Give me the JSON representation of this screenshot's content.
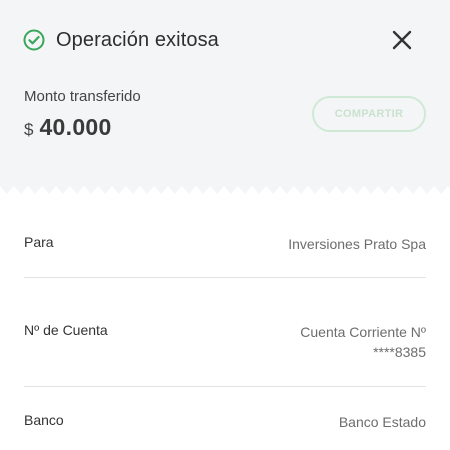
{
  "header": {
    "title": "Operación exitosa",
    "status_icon": "check-circle-icon",
    "close_icon": "close-icon"
  },
  "amount": {
    "label": "Monto transferido",
    "currency": "$",
    "value": "40.000"
  },
  "share_button": {
    "label": "COMPARTIR"
  },
  "details": [
    {
      "label": "Para",
      "value_lines": [
        "Inversiones Prato Spa"
      ]
    },
    {
      "label": "Nº de Cuenta",
      "value_lines": [
        "Cuenta Corriente Nº",
        "****8385"
      ]
    },
    {
      "label": "Banco",
      "value_lines": [
        "Banco Estado"
      ]
    }
  ],
  "colors": {
    "accent_green": "#3aa65c",
    "top_background": "#f4f5f6"
  }
}
